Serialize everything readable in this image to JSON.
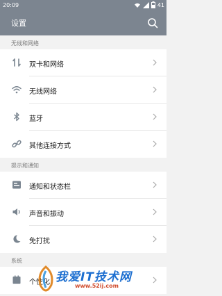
{
  "status_bar": {
    "time": "20:09",
    "battery": "41"
  },
  "header": {
    "title": "设置"
  },
  "sections": [
    {
      "title": "无线和网络",
      "items": [
        {
          "label": "双卡和网络",
          "icon": "dual-sim-icon"
        },
        {
          "label": "无线网络",
          "icon": "wifi-icon"
        },
        {
          "label": "蓝牙",
          "icon": "bluetooth-icon"
        },
        {
          "label": "其他连接方式",
          "icon": "link-icon"
        }
      ]
    },
    {
      "title": "提示和通知",
      "items": [
        {
          "label": "通知和状态栏",
          "icon": "notification-icon"
        },
        {
          "label": "声音和振动",
          "icon": "volume-icon"
        },
        {
          "label": "免打扰",
          "icon": "moon-icon"
        }
      ]
    },
    {
      "title": "系统",
      "items": [
        {
          "label": "个性化",
          "icon": "personalization-icon"
        }
      ]
    }
  ],
  "watermark": {
    "text": "我爱IT技术网",
    "url": "www.52ij.com"
  },
  "colors": {
    "header": "#7c8590",
    "icon": "#7a8590",
    "background": "#f2f2f2"
  }
}
